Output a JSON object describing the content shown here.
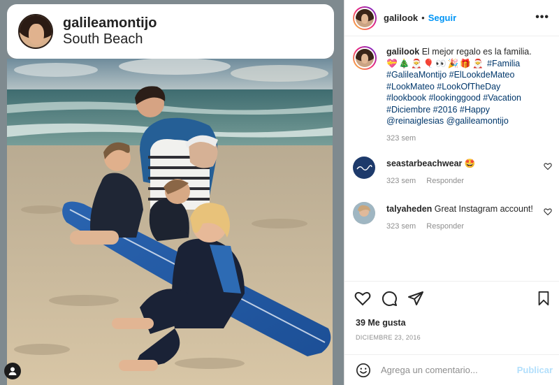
{
  "story": {
    "username": "galileamontijo",
    "location": "South Beach"
  },
  "post": {
    "username": "galilook",
    "follow_label": "Seguir",
    "separator": "•",
    "more_label": "•••",
    "caption_text": "El mejor regalo es la familia.",
    "caption_emojis": "💝🎄🎅🎈👀🎉🎁🎅",
    "caption_hashtags": "#Familia #GalileaMontijo #ElLookdeMateo #LookMateo #LookOfTheDay #lookbook #lookinggood #Vacation #Diciembre #2016 #Happy",
    "caption_mentions": "@reinaiglesias @galileamontijo",
    "caption_time": "323 sem"
  },
  "comments": [
    {
      "username": "seastarbeachwear",
      "text": "🤩",
      "time": "323 sem",
      "reply_label": "Responder",
      "avatar_color": "#1d3a6b"
    },
    {
      "username": "talyaheden",
      "text": "Great Instagram account!",
      "time": "323 sem",
      "reply_label": "Responder",
      "avatar_color": "#b8b4b0"
    }
  ],
  "engagement": {
    "likes": "39 Me gusta",
    "date": "DICIEMBRE 23, 2016"
  },
  "add_comment": {
    "placeholder": "Agrega un comentario...",
    "publish_label": "Publicar"
  },
  "colors": {
    "accent": "#0095f6",
    "publish_disabled": "#b2dffc",
    "hashtag": "#00376b"
  }
}
